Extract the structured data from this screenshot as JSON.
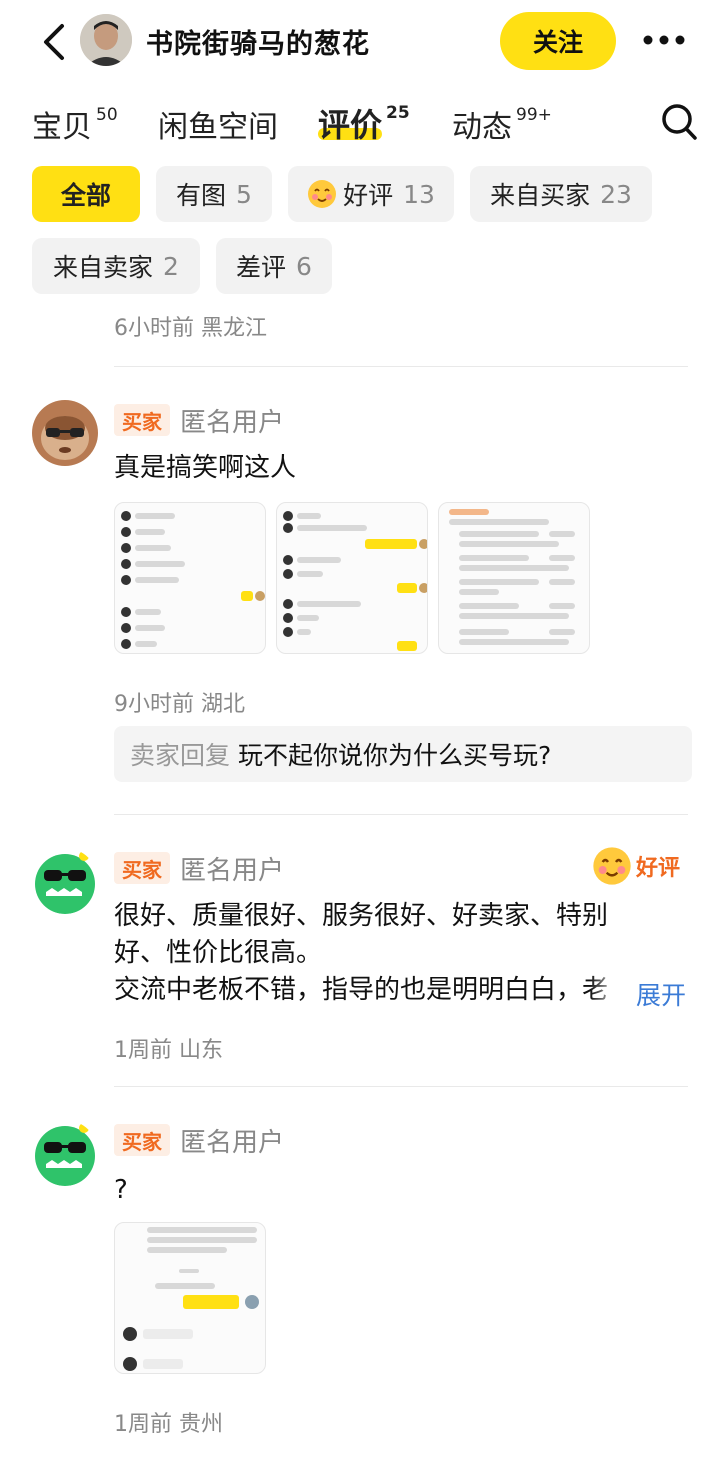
{
  "header": {
    "shop_name": "书院街骑马的葱花",
    "follow_label": "关注"
  },
  "tabs": [
    {
      "label": "宝贝",
      "count": "50"
    },
    {
      "label": "闲鱼空间",
      "count": ""
    },
    {
      "label": "评价",
      "count": "25"
    },
    {
      "label": "动态",
      "count": "99+"
    }
  ],
  "filters": [
    {
      "label": "全部",
      "count": ""
    },
    {
      "label": "有图",
      "count": "5"
    },
    {
      "label": "好评",
      "count": "13"
    },
    {
      "label": "来自买家",
      "count": "23"
    },
    {
      "label": "来自卖家",
      "count": "2"
    },
    {
      "label": "差评",
      "count": "6"
    }
  ],
  "top_meta": {
    "time": "6小时前",
    "location": "黑龙江"
  },
  "reviews": [
    {
      "badge": "买家",
      "user": "匿名用户",
      "text": "真是搞笑啊这人",
      "time": "9小时前",
      "location": "湖北",
      "reply_label": "卖家回复",
      "reply_text": "玩不起你说你为什么买号玩?"
    },
    {
      "badge": "买家",
      "user": "匿名用户",
      "rating": "好评",
      "text_line1": "很好、质量很好、服务很好、好卖家、特别",
      "text_line2": "好、性价比很高。",
      "text_line3": "交流中老板不错，指导的也是明明白白，老",
      "expand_label": "展开",
      "time": "1周前",
      "location": "山东"
    },
    {
      "badge": "买家",
      "user": "匿名用户",
      "text": "?",
      "time": "1周前",
      "location": "贵州"
    }
  ],
  "colors": {
    "accent": "#ffe013",
    "badge_text": "#f06a20",
    "link": "#3b7bd6"
  }
}
